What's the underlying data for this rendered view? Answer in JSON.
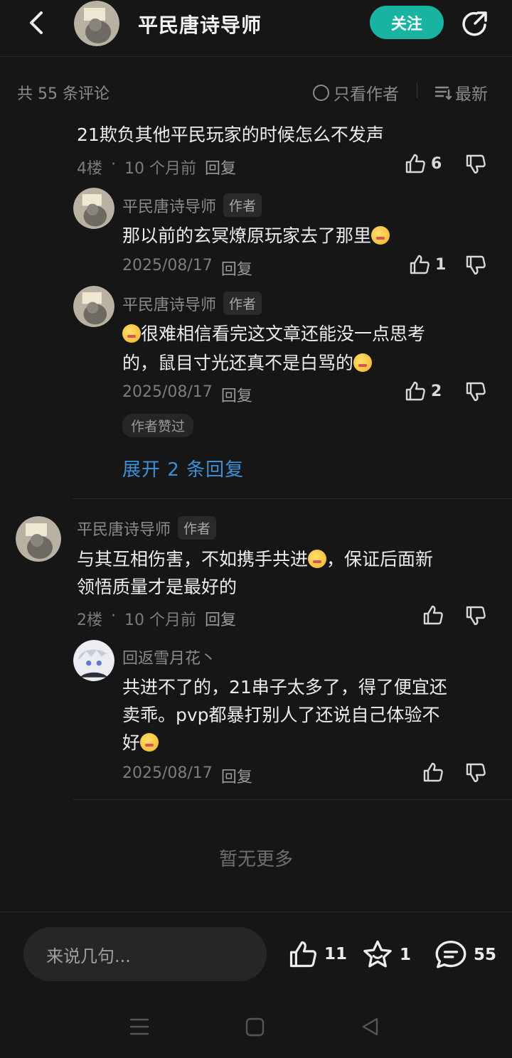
{
  "header": {
    "title": "平民唐诗导师",
    "follow_label": "关注"
  },
  "sort_bar": {
    "count_label": "共 55 条评论",
    "only_author_label": "只看作者",
    "sort_label": "最新"
  },
  "comments": [
    {
      "text": "21欺负其他平民玩家的时候怎么不发声",
      "floor": "4楼",
      "time": "10 个月前",
      "reply_label": "回复",
      "likes": "6",
      "replies": [
        {
          "name": "平民唐诗导师",
          "tag": "作者",
          "text": "那以前的玄冥燎原玩家去了那里",
          "date": "2025/08/17",
          "reply_label": "回复",
          "likes": "1"
        },
        {
          "name": "平民唐诗导师",
          "tag": "作者",
          "text_line1": "很难相信看完这文章还能没一点思考",
          "text_line2": "的，鼠目寸光还真不是白骂的",
          "date": "2025/08/17",
          "reply_label": "回复",
          "likes": "2",
          "liked_by_author": "作者赞过"
        }
      ],
      "expand_label": "展开 2 条回复"
    },
    {
      "name": "平民唐诗导师",
      "tag": "作者",
      "text_line1_a": "与其互相伤害，不如携手共进",
      "text_line1_b": "，保证后面新",
      "text_line2": "领悟质量才是最好的",
      "floor": "2楼",
      "time": "10 个月前",
      "reply_label": "回复",
      "replies": [
        {
          "name": "回返雪月花丶",
          "text_line1": "共进不了的，21串子太多了，得了便宜还",
          "text_line2": "卖乖。pvp都暴打别人了还说自己体验不",
          "text_line3": "好",
          "date": "2025/08/17",
          "reply_label": "回复"
        }
      ]
    }
  ],
  "no_more": "暂无更多",
  "bottom_bar": {
    "placeholder": "来说几句...",
    "likes": "11",
    "favorites": "1",
    "comments": "55"
  },
  "colors": {
    "accent": "#19b3a1",
    "link": "#3d8fd8",
    "background": "#161616"
  },
  "icons": [
    "back-arrow-icon",
    "share-icon",
    "thumb-up-icon",
    "thumb-down-icon",
    "star-icon",
    "comment-bubble-icon",
    "sort-lines-icon"
  ]
}
